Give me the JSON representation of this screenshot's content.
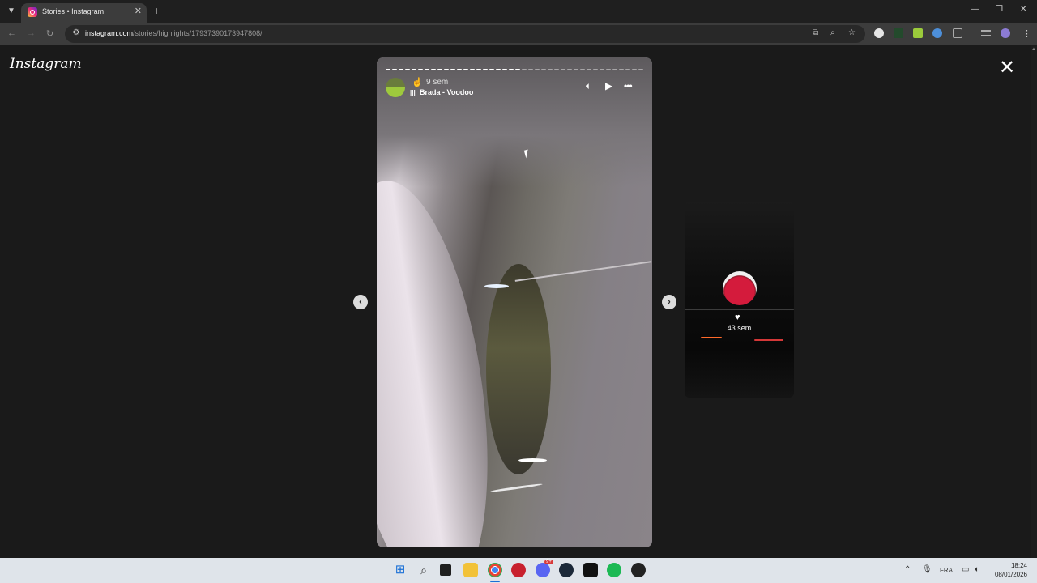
{
  "browser": {
    "tab_title": "Stories • Instagram",
    "url_host": "instagram.com",
    "url_path": "/stories/highlights/17937390173947808/"
  },
  "page": {
    "logo": "Instagram"
  },
  "story": {
    "time_ago": "9 sem",
    "song": "Brada - Voodoo",
    "progress_total_segments": 40,
    "progress_completed_segments": 21
  },
  "next_preview": {
    "time_ago": "43 sem"
  },
  "taskbar": {
    "language": "FRA",
    "time": "18:24",
    "date": "08/01/2026",
    "discord_badge": "9+"
  },
  "icons": [
    "tab-menu-icon",
    "instagram-favicon-icon",
    "close-icon",
    "plus-icon",
    "back-icon",
    "forward-icon",
    "reload-icon",
    "site-info-icon",
    "cast-icon",
    "zoom-icon",
    "star-icon",
    "music-bars-icon",
    "volume-icon",
    "play-icon",
    "more-icon",
    "chevron-left-icon",
    "chevron-right-icon",
    "heart-icon",
    "windows-start-icon",
    "search-icon",
    "file-explorer-icon",
    "chrome-icon",
    "spotify-icon",
    "steam-icon",
    "discord-icon",
    "microphone-icon",
    "speaker-icon"
  ],
  "colors": {
    "page_bg": "#1a1a1a",
    "tab_active": "#3c3c3c",
    "taskbar": "#dfe4ea"
  }
}
